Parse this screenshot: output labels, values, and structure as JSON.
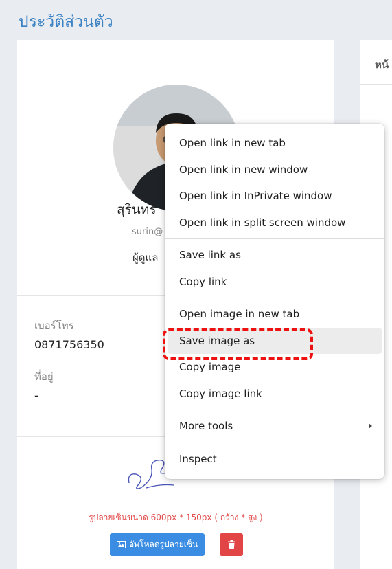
{
  "page": {
    "title": "ประวัติส่วนตัว"
  },
  "profile": {
    "name": "สุรินทร์",
    "email": "surin@",
    "role": "ผู้ดูแล"
  },
  "fields": {
    "phone_label": "เบอร์โทร",
    "phone_value": "0871756350",
    "address_label": "ที่อยู่",
    "address_value": "-"
  },
  "signature": {
    "note": "รูปลายเซ็นขนาด 600px * 150px ( กว้าง * สูง )",
    "upload_label": "อัพโหลดรูปลายเซ็น"
  },
  "right_panel": {
    "tab_label": "หน้"
  },
  "context_menu": {
    "items": [
      "Open link in new tab",
      "Open link in new window",
      "Open link in InPrivate window",
      "Open link in split screen window",
      "Save link as",
      "Copy link",
      "Open image in new tab",
      "Save image as",
      "Copy image",
      "Copy image link",
      "More tools",
      "Inspect"
    ],
    "highlighted": "Save image as"
  },
  "colors": {
    "title": "#3b82c4",
    "upload_button": "#3a8de3",
    "delete_button": "#e24545",
    "note": "#e24b4b",
    "highlight_border": "#ee1111"
  }
}
